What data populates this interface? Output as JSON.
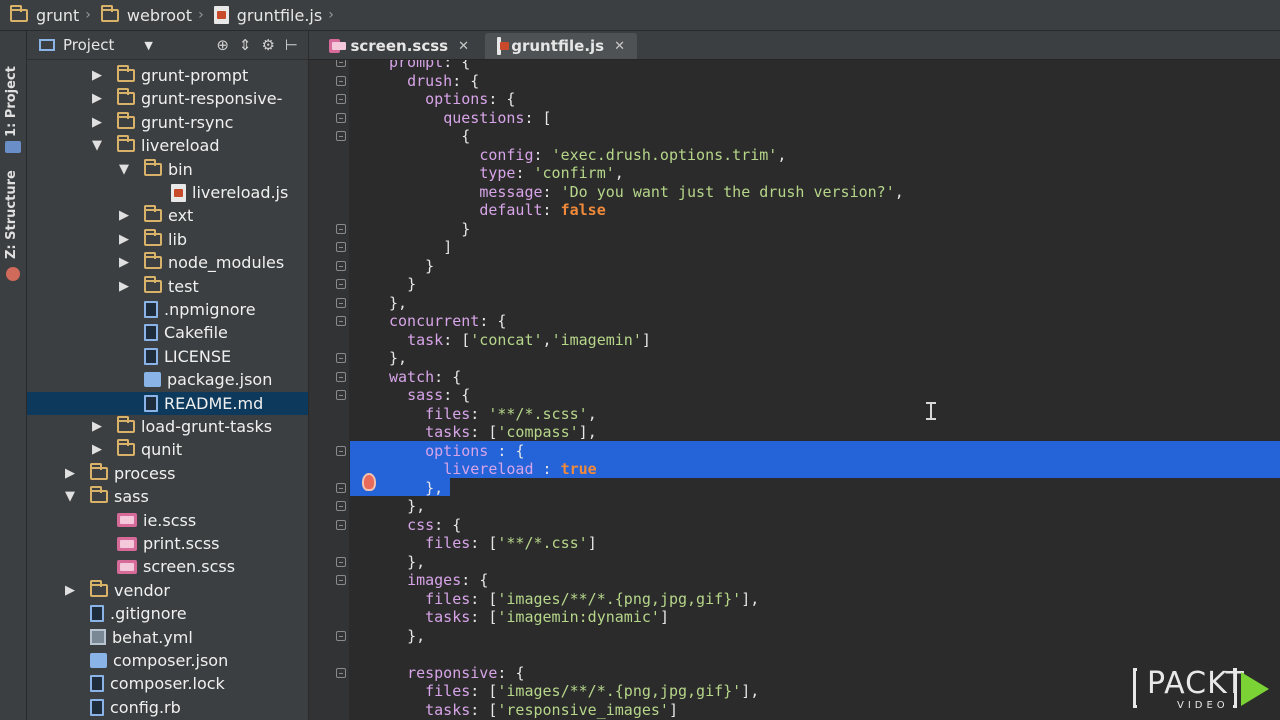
{
  "breadcrumb": [
    "grunt",
    "webroot",
    "gruntfile.js"
  ],
  "side_tabs": [
    "1: Project",
    "Z: Structure"
  ],
  "project_panel": {
    "title": "Project",
    "tree": [
      {
        "label": "grunt-prompt",
        "type": "folder",
        "depth": 1,
        "expanded": false
      },
      {
        "label": "grunt-responsive-",
        "type": "folder",
        "depth": 1,
        "expanded": false
      },
      {
        "label": "grunt-rsync",
        "type": "folder",
        "depth": 1,
        "expanded": false
      },
      {
        "label": "livereload",
        "type": "folder",
        "depth": 1,
        "expanded": true
      },
      {
        "label": "bin",
        "type": "folder",
        "depth": 2,
        "expanded": true
      },
      {
        "label": "livereload.js",
        "type": "js",
        "depth": 3
      },
      {
        "label": "ext",
        "type": "folder",
        "depth": 2,
        "expanded": false
      },
      {
        "label": "lib",
        "type": "folder",
        "depth": 2,
        "expanded": false
      },
      {
        "label": "node_modules",
        "type": "folder",
        "depth": 2,
        "expanded": false
      },
      {
        "label": "test",
        "type": "folder",
        "depth": 2,
        "expanded": false
      },
      {
        "label": ".npmignore",
        "type": "doc",
        "depth": 2
      },
      {
        "label": "Cakefile",
        "type": "doc",
        "depth": 2
      },
      {
        "label": "LICENSE",
        "type": "doc",
        "depth": 2
      },
      {
        "label": "package.json",
        "type": "json",
        "depth": 2
      },
      {
        "label": "README.md",
        "type": "doc",
        "depth": 2,
        "selected": true
      },
      {
        "label": "load-grunt-tasks",
        "type": "folder",
        "depth": 1,
        "expanded": false
      },
      {
        "label": "qunit",
        "type": "folder",
        "depth": 1,
        "expanded": false
      },
      {
        "label": "process",
        "type": "folder",
        "depth": 0,
        "expanded": false
      },
      {
        "label": "sass",
        "type": "folder",
        "depth": 0,
        "expanded": true
      },
      {
        "label": "ie.scss",
        "type": "scss",
        "depth": 1
      },
      {
        "label": "print.scss",
        "type": "scss",
        "depth": 1
      },
      {
        "label": "screen.scss",
        "type": "scss",
        "depth": 1
      },
      {
        "label": "vendor",
        "type": "folder",
        "depth": 0,
        "expanded": false
      },
      {
        "label": ".gitignore",
        "type": "doc",
        "depth": 0
      },
      {
        "label": "behat.yml",
        "type": "yml",
        "depth": 0
      },
      {
        "label": "composer.json",
        "type": "json",
        "depth": 0
      },
      {
        "label": "composer.lock",
        "type": "doc",
        "depth": 0
      },
      {
        "label": "config.rb",
        "type": "doc",
        "depth": 0
      }
    ]
  },
  "editor_tabs": [
    {
      "label": "screen.scss",
      "active": false,
      "icon": "scss-file-icon"
    },
    {
      "label": "gruntfile.js",
      "active": true,
      "icon": "js-file-icon"
    }
  ],
  "code_lines": [
    "prompt: {",
    "  drush: {",
    "    options: {",
    "      questions: [",
    "        {",
    "          config: 'exec.drush.options.trim',",
    "          type: 'confirm',",
    "          message: 'Do you want just the drush version?',",
    "          default: false",
    "        }",
    "      ]",
    "    }",
    "  }",
    "},",
    "concurrent: {",
    "  task: ['concat','imagemin']",
    "},",
    "watch: {",
    "  sass: {",
    "    files: '**/*.scss',",
    "    tasks: ['compass'],",
    "    options : {",
    "      livereload : true",
    "    },",
    "  },",
    "  css: {",
    "    files: ['**/*.css']",
    "  },",
    "  images: {",
    "    files: ['images/**/*.{png,jpg,gif}'],",
    "    tasks: ['imagemin:dynamic']",
    "  },",
    "",
    "  responsive: {",
    "    files: ['images/**/*.{png,jpg,gif}'],",
    "    tasks: ['responsive_images']"
  ],
  "selected_lines": [
    21,
    22,
    23
  ],
  "watermark": {
    "brand": "PACKT",
    "sub": "VIDEO"
  },
  "colors": {
    "keyword": "#d7a4e8",
    "string": "#b6d68a",
    "boolean": "#f08a3a",
    "selection": "#2463d8"
  }
}
